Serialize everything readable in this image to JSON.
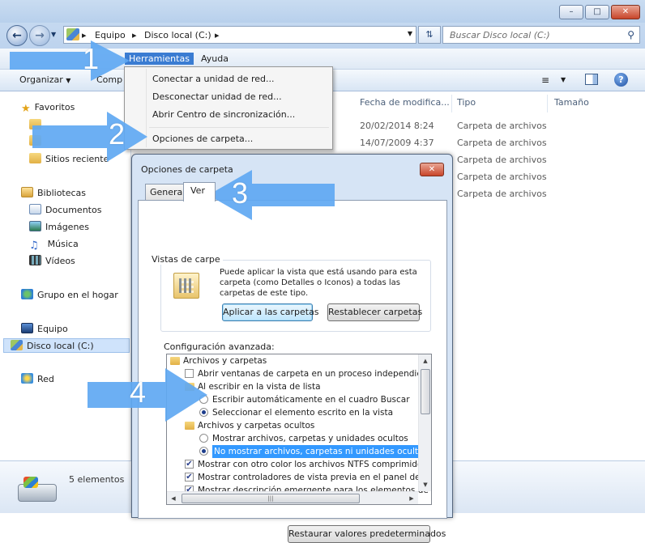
{
  "window": {
    "minimize_label": "–",
    "maximize_label": "□",
    "close_label": "✕"
  },
  "address": {
    "crumbs": [
      "Equipo",
      "Disco local (C:)"
    ],
    "search_placeholder": "Buscar Disco local (C:)"
  },
  "menubar": {
    "items": [
      "Herramientas",
      "Ayuda"
    ]
  },
  "toolbar": {
    "organize": "Organizar",
    "compartir": "Comp"
  },
  "dropdown": {
    "items": [
      "Conectar a unidad de red...",
      "Desconectar unidad de red...",
      "Abrir Centro de sincronización...",
      "Opciones de carpeta..."
    ]
  },
  "navpane": {
    "favoritos": "Favoritos",
    "sitios": "Sitios reciente",
    "bibliotecas": "Bibliotecas",
    "documentos": "Documentos",
    "imagenes": "Imágenes",
    "musica": "Música",
    "videos": "Vídeos",
    "grupo": "Grupo en el hogar",
    "equipo": "Equipo",
    "disco": "Disco local (C:)",
    "red": "Red"
  },
  "filelist": {
    "columns": [
      "Fecha de modifica...",
      "Tipo",
      "Tamaño"
    ],
    "rows": [
      {
        "date": "20/02/2014 8:24",
        "type": "Carpeta de archivos"
      },
      {
        "date": "14/07/2009 4:37",
        "type": "Carpeta de archivos"
      },
      {
        "date": "",
        "type": "Carpeta de archivos"
      },
      {
        "date": "",
        "type": "Carpeta de archivos"
      },
      {
        "date": "",
        "type": "Carpeta de archivos"
      }
    ]
  },
  "status": {
    "count": "5 elementos"
  },
  "dialog": {
    "title": "Opciones de carpeta",
    "close_label": "✕",
    "tabs": [
      "General",
      "Ver"
    ],
    "vistas_label": "Vistas de carpe",
    "vistas_text": "Puede aplicar la vista que está usando para esta carpeta (como Detalles o Iconos) a todas las carpetas de este tipo.",
    "apply_button": "Aplicar a las carpetas",
    "reset_button": "Restablecer carpetas",
    "advanced_label": "Configuración avanzada:",
    "restore_button": "Restaurar valores predeterminados",
    "advanced_items": [
      {
        "kind": "folder",
        "indent": 0,
        "text": "Archivos y carpetas"
      },
      {
        "kind": "checkbox",
        "checked": false,
        "indent": 1,
        "text": "Abrir ventanas de carpeta en un proceso independiente"
      },
      {
        "kind": "folder",
        "indent": 1,
        "text": "Al escribir en la vista de lista"
      },
      {
        "kind": "radio",
        "checked": false,
        "indent": 2,
        "text": "Escribir automáticamente en el cuadro Buscar"
      },
      {
        "kind": "radio",
        "checked": true,
        "indent": 2,
        "text": "Seleccionar el elemento escrito en la vista"
      },
      {
        "kind": "folder",
        "indent": 1,
        "text": "Archivos y carpetas ocultos"
      },
      {
        "kind": "radio",
        "checked": false,
        "indent": 2,
        "text": "Mostrar archivos, carpetas y unidades ocultos"
      },
      {
        "kind": "radio",
        "checked": true,
        "indent": 2,
        "selected": true,
        "text": "No mostrar archivos, carpetas ni unidades ocultos"
      },
      {
        "kind": "checkbox",
        "checked": true,
        "indent": 1,
        "text": "Mostrar con otro color los archivos NTFS comprimidos o c"
      },
      {
        "kind": "checkbox",
        "checked": true,
        "indent": 1,
        "text": "Mostrar controladores de vista previa en el panel de vista"
      },
      {
        "kind": "checkbox",
        "checked": true,
        "indent": 1,
        "text": "Mostrar descripción emergente para los elementos de car"
      }
    ]
  },
  "annotations": {
    "numbers": [
      "1",
      "2",
      "3",
      "4"
    ],
    "color": "#5fa8f2"
  }
}
